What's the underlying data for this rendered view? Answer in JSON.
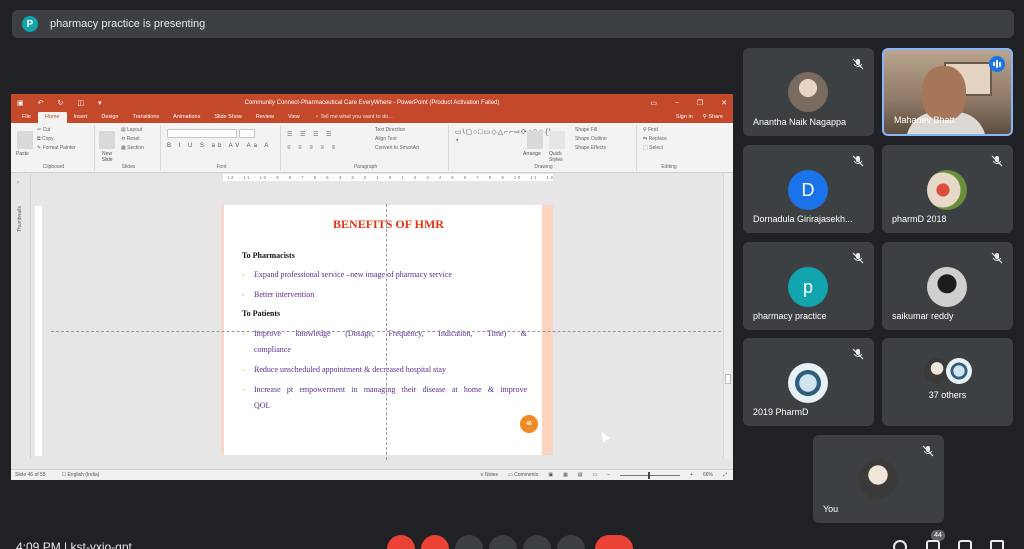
{
  "banner": {
    "avatar_letter": "P",
    "text": "pharmacy practice is presenting"
  },
  "ppt": {
    "window_title": "Community Connect-Pharmaceutical Care EveryWhere - PowerPoint (Product Activation Failed)",
    "tabs": [
      "File",
      "Home",
      "Insert",
      "Design",
      "Transitions",
      "Animations",
      "Slide Show",
      "Review",
      "View"
    ],
    "tell_me": "Tell me what you want to do...",
    "sign_in": "Sign in",
    "share": "Share",
    "ribbon": {
      "clipboard": {
        "label": "Clipboard",
        "paste": "Paste",
        "cut": "Cut",
        "copy": "Copy",
        "format_painter": "Format Painter"
      },
      "slides": {
        "label": "Slides",
        "new_slide": "New Slide",
        "layout": "Layout",
        "reset": "Reset",
        "section": "Section"
      },
      "font": {
        "label": "Font"
      },
      "paragraph": {
        "label": "Paragraph",
        "text_direction": "Text Direction",
        "align_text": "Align Text",
        "convert_smartart": "Convert to SmartArt"
      },
      "drawing": {
        "label": "Drawing",
        "arrange": "Arrange",
        "quick_styles": "Quick Styles",
        "shape_fill": "Shape Fill",
        "shape_outline": "Shape Outline",
        "shape_effects": "Shape Effects"
      },
      "editing": {
        "label": "Editing",
        "find": "Find",
        "replace": "Replace",
        "select": "Select"
      }
    },
    "ruler_text": "12 · 11 · 10 · 9 · 8 · 7 · 6 · 5 · 4 · 3 · 2 · 1 · 0 · 1 · 2 · 3 · 4 · 5 · 6 · 7 · 8 · 9 · 10 · 11 · 12",
    "thumbnails_label": "Thumbnails",
    "slide": {
      "title": "BENEFITS OF HMR",
      "section1": "To Pharmacists",
      "bullets1": [
        "Expand professional service –new image of pharmacy service",
        "Better intervention"
      ],
      "section2": "To Patients",
      "bullets2": [
        {
          "line1": "Improve knowledge (Dosage, Frequency, Indication, Time) &",
          "line2": "compliance"
        },
        {
          "line1": "Reduce unscheduled appointment & decreased hospital stay"
        },
        {
          "line1": "Increase pt empowerment in managing their disease at home & improve",
          "line2": "QOL"
        }
      ],
      "page_number": "46"
    },
    "status": {
      "slide_of": "Slide 46 of 55",
      "language": "English (India)",
      "notes": "Notes",
      "comments": "Comments",
      "zoom": "66%"
    }
  },
  "participants": [
    {
      "name": "Anantha Naik Nagappa",
      "muted": true
    },
    {
      "name": "Mahadev Bhatt",
      "speaking": true
    },
    {
      "name": "Dornadula Girirajasekh...",
      "avatar_letter": "D",
      "avatar_color": "#1a73e8",
      "muted": true
    },
    {
      "name": "pharmD 2018",
      "muted": true
    },
    {
      "name": "pharmacy practice",
      "avatar_letter": "p",
      "avatar_color": "#12a4af",
      "muted": true
    },
    {
      "name": "saikumar reddy",
      "muted": true
    },
    {
      "name": "2019 PharmD",
      "muted": true
    },
    {
      "others_count": "37 others"
    },
    {
      "name": "You",
      "muted": true
    }
  ],
  "bottom": {
    "clock": "4:09 PM",
    "meeting_code": "kst-yxjo-qpt",
    "participant_badge": "44"
  },
  "colors": {
    "accent": "#8ab4f8",
    "ppt_orange": "#c4492b",
    "red": "#ea4335"
  }
}
